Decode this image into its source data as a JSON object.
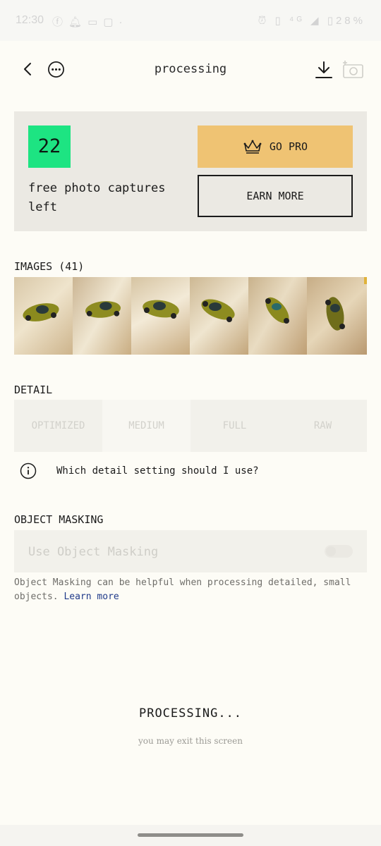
{
  "status_bar": {
    "time": "12:30",
    "left_icons": [
      "facebook-icon",
      "notification-icon",
      "sim-icon",
      "message-icon",
      "dot-icon"
    ],
    "right_icons": [
      "alarm-icon",
      "hd-icon",
      "4g-icon",
      "signal-icon",
      "battery-icon"
    ],
    "battery": "28%"
  },
  "header": {
    "title": "processing"
  },
  "pro_card": {
    "captures_count": "22",
    "captures_text": "free photo captures left",
    "go_pro_label": "GO PRO",
    "earn_more_label": "EARN MORE",
    "go_pro_color": "#efc373",
    "count_color": "#1de482"
  },
  "images": {
    "label": "IMAGES (41)",
    "thumbnails": [
      "thumb-1",
      "thumb-2",
      "thumb-3",
      "thumb-4",
      "thumb-5",
      "thumb-6"
    ]
  },
  "detail": {
    "label": "DETAIL",
    "options": [
      "OPTIMIZED",
      "MEDIUM",
      "FULL",
      "RAW"
    ],
    "selected": "MEDIUM",
    "help_text": "Which detail setting should I use?"
  },
  "masking": {
    "label": "OBJECT MASKING",
    "toggle_label": "Use Object Masking",
    "toggle_on": false,
    "note": "Object Masking can be helpful when processing detailed, small objects.",
    "learn_more": "Learn more"
  },
  "processing": {
    "title": "PROCESSING...",
    "subtitle": "you may exit this screen"
  }
}
